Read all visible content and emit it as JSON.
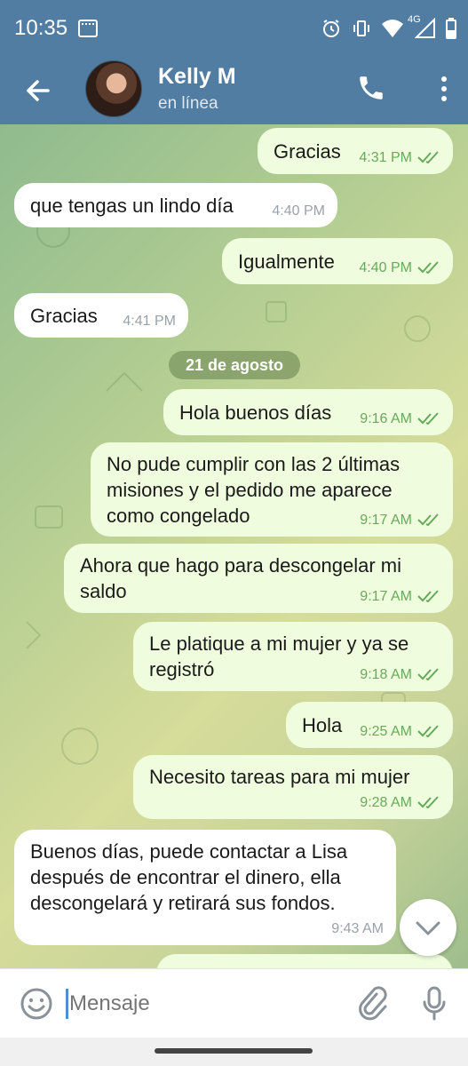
{
  "status_bar": {
    "time": "10:35",
    "network": "4G"
  },
  "header": {
    "contact_name": "Kelly M",
    "contact_status": "en línea"
  },
  "messages": [
    {
      "dir": "out",
      "text": "Gracias",
      "time": "4:31 PM"
    },
    {
      "dir": "in",
      "text": "que tengas un lindo día",
      "time": "4:40 PM"
    },
    {
      "dir": "out",
      "text": "Igualmente",
      "time": "4:40 PM"
    },
    {
      "dir": "in",
      "text": "Gracias",
      "time": "4:41 PM"
    },
    {
      "dir": "out",
      "text": "Hola buenos días",
      "time": "9:16 AM"
    },
    {
      "dir": "out",
      "text_lines": [
        "No pude cumplir con las 2 últimas",
        "misiones y el pedido me aparece",
        "como congelado"
      ],
      "time": "9:17 AM"
    },
    {
      "dir": "out",
      "text_lines": [
        "Ahora que hago para descongelar mi",
        "saldo"
      ],
      "time": "9:17 AM"
    },
    {
      "dir": "out",
      "text_lines": [
        "Le platique a mi mujer y ya se",
        "registró"
      ],
      "time": "9:18 AM"
    },
    {
      "dir": "out",
      "text": "Hola",
      "time": "9:25 AM"
    },
    {
      "dir": "out",
      "text": "Necesito tareas para mi mujer",
      "time": "9:28 AM"
    },
    {
      "dir": "in",
      "text_lines": [
        "Buenos días, puede contactar a Lisa",
        "después de encontrar el dinero, ella",
        "descongelará y retirará sus fondos."
      ],
      "time": "9:43 AM"
    }
  ],
  "date_separator": "21 de agosto",
  "input": {
    "placeholder": "Mensaje"
  },
  "colors": {
    "header": "#517da2",
    "outgoing_bubble": "#effdde",
    "incoming_bubble": "#ffffff",
    "read_check": "#67a95a"
  }
}
